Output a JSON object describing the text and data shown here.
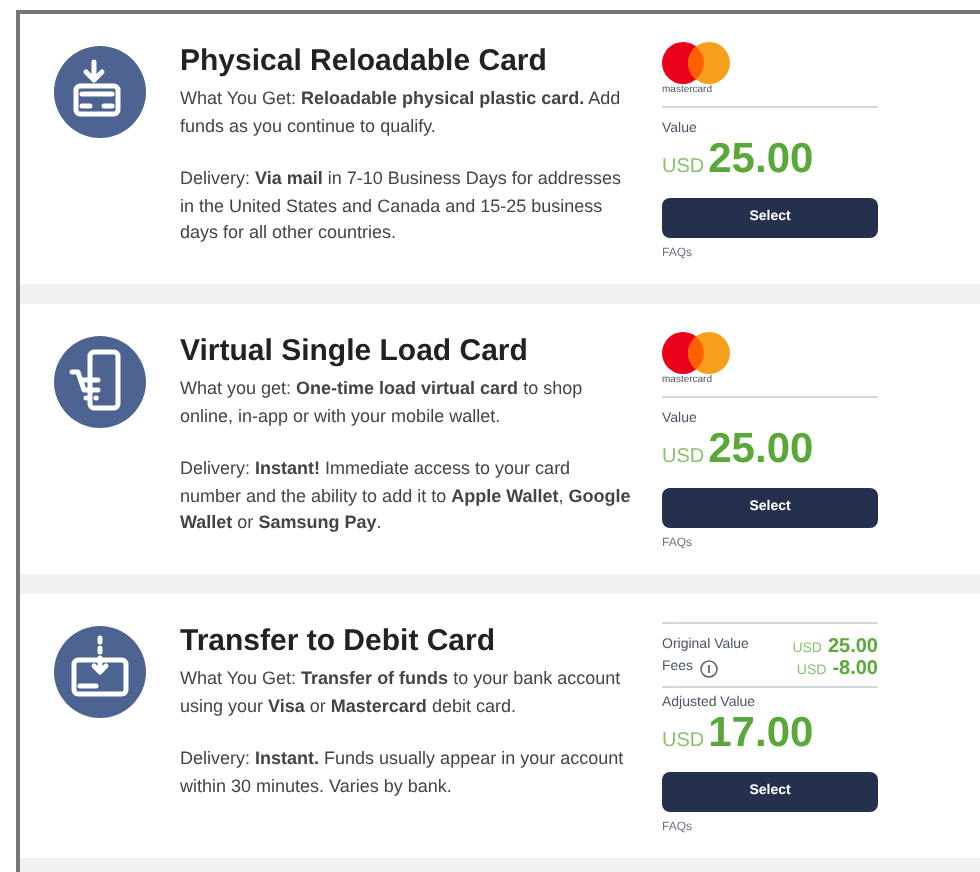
{
  "cards": [
    {
      "kind": "physical",
      "title": "Physical Reloadable Card",
      "description": "What You Get: **Reloadable physical plastic card.** Add funds as you continue to qualify.",
      "delivery": "Delivery: **Via mail** in 7-10 Business Days for addresses in the United States and Canada and 15-25 business days for all other countries.",
      "pricing": {
        "kind": "single",
        "logo_caption": "mastercard",
        "value_label": "Value",
        "currency": "USD",
        "amount": "25.00"
      },
      "button": "Select",
      "link": "FAQs"
    },
    {
      "kind": "virtual",
      "title": "Virtual Single Load Card",
      "description": "What you get: **One-time load virtual card** to shop online, in-app or with your mobile wallet.",
      "delivery": "Delivery: **Instant!** Immediate access to your card number and the ability to add it to **Apple Wallet**, **Google Wallet** or **Samsung Pay**.",
      "pricing": {
        "kind": "single",
        "logo_caption": "mastercard",
        "value_label": "Value",
        "currency": "USD",
        "amount": "25.00"
      },
      "button": "Select",
      "link": "FAQs"
    },
    {
      "kind": "transfer",
      "title": "Transfer to Debit Card",
      "description": "What You Get: **Transfer of funds** to your bank account using your **Visa** or **Mastercard** debit card.",
      "delivery": "Delivery: **Instant.** Funds usually appear in your account within 30 minutes. Varies by bank.",
      "pricing": {
        "kind": "breakdown",
        "lines": [
          {
            "label": "Original Value",
            "currency": "USD",
            "amount": "25.00",
            "info": false
          },
          {
            "label": "Fees",
            "currency": "USD",
            "amount": "-8.00",
            "info": true
          }
        ],
        "value_label": "Adjusted Value",
        "currency": "USD",
        "amount": "17.00"
      },
      "button": "Select",
      "link": "FAQs"
    }
  ]
}
